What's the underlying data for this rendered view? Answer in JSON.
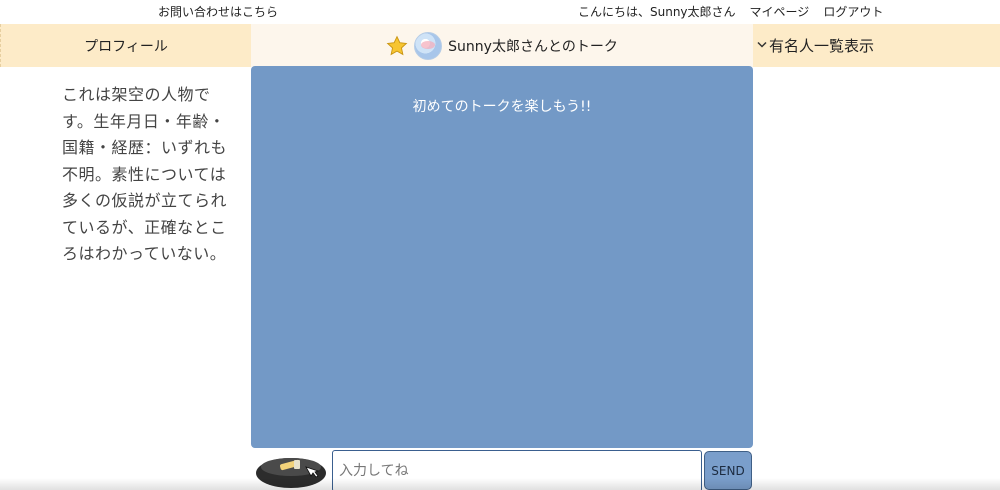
{
  "topbar": {
    "contact_link": "お問い合わせはこちら",
    "greeting": "こんにちは、Sunny太郎さん",
    "mypage_link": "マイページ",
    "logout_link": "ログアウト"
  },
  "header": {
    "profile_tab": "プロフィール",
    "talk_title": "Sunny太郎さんとのトーク",
    "celeb_list": "有名人一覧表示"
  },
  "profile": {
    "description": "これは架空の人物です。生年月日・年齢・国籍・経歴：いずれも不明。素性については多くの仮説が立てられているが、正確なところはわかっていない。"
  },
  "chat": {
    "welcome": "初めてのトークを楽しもう!!"
  },
  "composer": {
    "placeholder": "入力してね",
    "send_label": "SEND"
  },
  "icons": {
    "favorite": "star-icon",
    "avatar": "avatar-icon",
    "expand": "chevron-down-icon",
    "sticker": "sticker-icon"
  },
  "colors": {
    "header_tab": "#fdebc8",
    "chat_bg": "#7399c6",
    "send_bg": "#7a9ecb"
  }
}
